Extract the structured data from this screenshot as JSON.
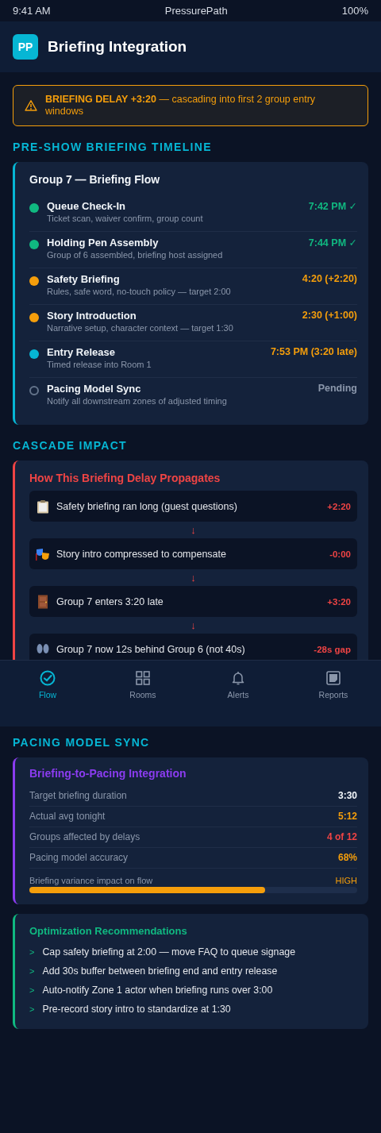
{
  "status_bar": {
    "time": "9:41 AM",
    "app": "PressurePath",
    "battery": "100%"
  },
  "header": {
    "logo": "PP",
    "title": "Briefing Integration"
  },
  "alert": {
    "text": "**BRIEFING DELAY +3:20** — cascading into first 2 group entry windows"
  },
  "timeline": {
    "section": "PRE-SHOW BRIEFING TIMELINE",
    "title": "Group 7 — Briefing Flow",
    "steps": [
      {
        "name": "Queue Check-In",
        "detail": "Ticket scan, waiver confirm, group count",
        "value": "7:42 PM ✓",
        "kind": "done",
        "color": "#10b981"
      },
      {
        "name": "Holding Pen Assembly",
        "detail": "Group of 6 assembled, briefing host assigned",
        "value": "7:44 PM ✓",
        "kind": "done",
        "color": "#10b981"
      },
      {
        "name": "Safety Briefing",
        "detail": "Rules, safe word, no-touch policy — target 2:00",
        "value": "4:20 (+2:20)",
        "kind": "late",
        "color": "#f59e0b"
      },
      {
        "name": "Story Introduction",
        "detail": "Narrative setup, character context — target 1:30",
        "value": "2:30 (+1:00)",
        "kind": "late",
        "color": "#f59e0b"
      },
      {
        "name": "Entry Release",
        "detail": "Timed release into Room 1",
        "value": "7:53 PM (3:20 late)",
        "kind": "late",
        "color": "#06b6d4"
      },
      {
        "name": "Pacing Model Sync",
        "detail": "Notify all downstream zones of adjusted timing",
        "value": "Pending",
        "kind": "pending",
        "color": "#64748b"
      }
    ]
  },
  "cascade": {
    "section": "CASCADE IMPACT",
    "title": "How This Briefing Delay Propagates",
    "arrow": "↓",
    "steps": [
      {
        "text": "Safety briefing ran long (guest questions)",
        "value": "+2:20"
      },
      {
        "text": "Story intro compressed to compensate",
        "value": "-0:00"
      },
      {
        "text": "Group 7 enters 3:20 late",
        "value": "+3:20"
      },
      {
        "text": "Group 7 now 12s behind Group 6 (not 40s)",
        "value": "-28s gap"
      }
    ]
  },
  "pacing": {
    "section": "PACING MODEL SYNC",
    "title": "Briefing-to-Pacing Integration",
    "metrics": [
      {
        "label": "Target briefing duration",
        "value": "3:30",
        "color": "#f1f5f9"
      },
      {
        "label": "Actual avg tonight",
        "value": "5:12",
        "color": "#f59e0b"
      },
      {
        "label": "Groups affected by delays",
        "value": "4 of 12",
        "color": "#ef4444"
      },
      {
        "label": "Pacing model accuracy",
        "value": "68%",
        "color": "#f59e0b"
      }
    ],
    "impact": {
      "label": "Briefing variance impact on flow",
      "reading": "HIGH",
      "level": 0.72
    }
  },
  "recommendations": {
    "title": "Optimization Recommendations",
    "bullet": ">",
    "items": [
      "Cap safety briefing at 2:00 — move FAQ to queue signage",
      "Add 30s buffer between briefing end and entry release",
      "Auto-notify Zone 1 actor when briefing runs over 3:00",
      "Pre-record story intro to standardize at 1:30"
    ]
  },
  "nav": [
    {
      "label": "Flow",
      "selected": true
    },
    {
      "label": "Rooms",
      "selected": false
    },
    {
      "label": "Alerts",
      "selected": false
    },
    {
      "label": "Reports",
      "selected": false
    }
  ]
}
